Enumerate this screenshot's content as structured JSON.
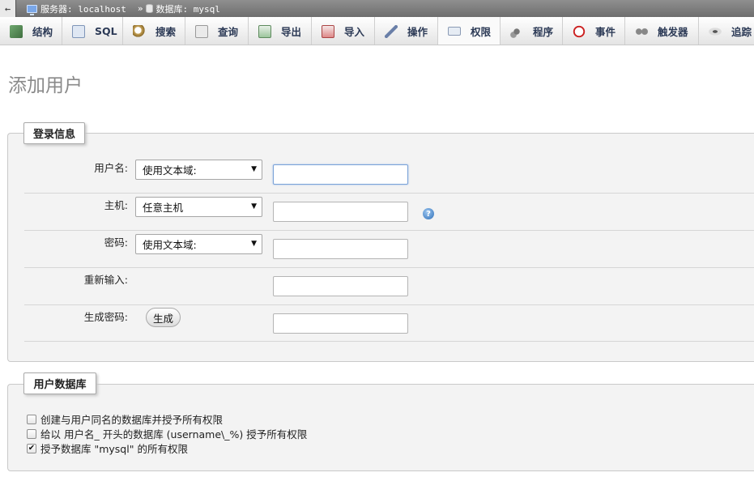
{
  "breadcrumb": {
    "back_glyph": "←",
    "server_text": "服务器: localhost",
    "separator": "»",
    "database_text": "数据库: mysql"
  },
  "tabs": [
    {
      "label": "结构",
      "icon": "structure-icon",
      "active": false
    },
    {
      "label": "SQL",
      "icon": "sql-icon",
      "active": false
    },
    {
      "label": "搜索",
      "icon": "search-icon",
      "active": false
    },
    {
      "label": "查询",
      "icon": "query-icon",
      "active": false
    },
    {
      "label": "导出",
      "icon": "export-icon",
      "active": false
    },
    {
      "label": "导入",
      "icon": "import-icon",
      "active": false
    },
    {
      "label": "操作",
      "icon": "wrench-icon",
      "active": false
    },
    {
      "label": "权限",
      "icon": "privileges-icon",
      "active": true
    },
    {
      "label": "程序",
      "icon": "routines-icon",
      "active": false
    },
    {
      "label": "事件",
      "icon": "clock-icon",
      "active": false
    },
    {
      "label": "触发器",
      "icon": "triggers-icon",
      "active": false
    },
    {
      "label": "追踪",
      "icon": "eye-icon",
      "active": false
    }
  ],
  "page_title": "添加用户",
  "login_info": {
    "legend": "登录信息",
    "username_label": "用户名:",
    "username_select": "使用文本域:",
    "host_label": "主机:",
    "host_select": "任意主机",
    "password_label": "密码:",
    "password_select": "使用文本域:",
    "retype_label": "重新输入:",
    "generate_label": "生成密码:",
    "generate_button": "生成",
    "help_glyph": "?"
  },
  "user_database": {
    "legend": "用户数据库",
    "options": [
      {
        "label": "创建与用户同名的数据库并授予所有权限",
        "checked": false
      },
      {
        "label": "给以 用户名_ 开头的数据库 (username\\_%) 授予所有权限",
        "checked": false
      },
      {
        "label": "授予数据库 \"mysql\" 的所有权限",
        "checked": true
      }
    ]
  },
  "colors": {
    "tab_text": "#2c3a56",
    "title": "#8a8a8a",
    "fieldset_bg": "#f3f3f3",
    "breadcrumb_bg": "#7e7e7e"
  }
}
